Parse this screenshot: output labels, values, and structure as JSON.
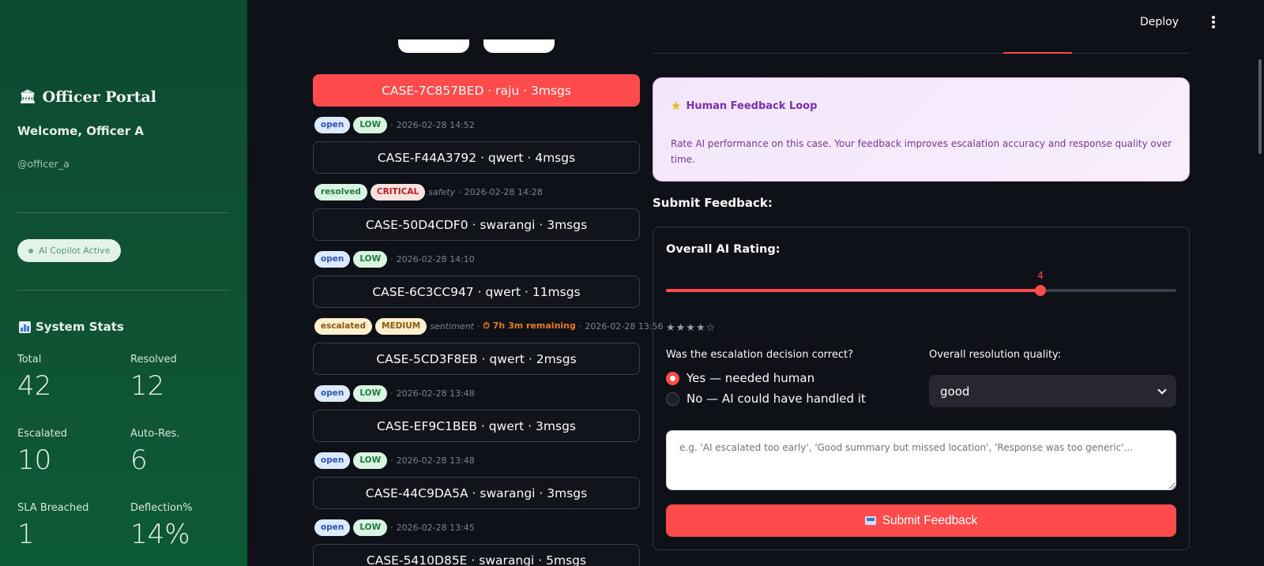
{
  "sidebar": {
    "portal_title": "Officer Portal",
    "welcome": "Welcome, Officer A",
    "username": "@officer_a",
    "copilot_status": "AI Copilot Active",
    "stats_title": "System Stats",
    "stats": [
      {
        "label": "Total",
        "value": "42"
      },
      {
        "label": "Resolved",
        "value": "12"
      },
      {
        "label": "Escalated",
        "value": "10"
      },
      {
        "label": "Auto-Res.",
        "value": "6"
      },
      {
        "label": "SLA Breached",
        "value": "1"
      },
      {
        "label": "Deflection%",
        "value": "14%"
      }
    ]
  },
  "header": {
    "deploy_label": "Deploy"
  },
  "cases": [
    {
      "label": "CASE-7C857BED · raju · 3msgs",
      "status": "open",
      "priority": "LOW",
      "category": "",
      "sla": "",
      "time": "2026-02-28 14:52"
    },
    {
      "label": "CASE-F44A3792 · qwert · 4msgs",
      "status": "resolved",
      "priority": "CRITICAL",
      "category": "safety",
      "sla": "",
      "time": "2026-02-28 14:28"
    },
    {
      "label": "CASE-50D4CDF0 · swarangi · 3msgs",
      "status": "open",
      "priority": "LOW",
      "category": "",
      "sla": "",
      "time": "2026-02-28 14:10"
    },
    {
      "label": "CASE-6C3CC947 · qwert · 11msgs",
      "status": "escalated",
      "priority": "MEDIUM",
      "category": "sentiment",
      "sla": "7h 3m remaining",
      "time": "2026-02-28 13:56"
    },
    {
      "label": "CASE-5CD3F8EB · qwert · 2msgs",
      "status": "open",
      "priority": "LOW",
      "category": "",
      "sla": "",
      "time": "2026-02-28 13:48"
    },
    {
      "label": "CASE-EF9C1BEB · qwert · 3msgs",
      "status": "open",
      "priority": "LOW",
      "category": "",
      "sla": "",
      "time": "2026-02-28 13:48"
    },
    {
      "label": "CASE-44C9DA5A · swarangi · 3msgs",
      "status": "open",
      "priority": "LOW",
      "category": "",
      "sla": "",
      "time": "2026-02-28 13:45"
    },
    {
      "label": "CASE-5410D85E · swarangi · 5msgs"
    }
  ],
  "feedback": {
    "card_title": "Human Feedback Loop",
    "card_body": "Rate AI performance on this case. Your feedback improves escalation accuracy and response quality over time.",
    "section_title": "Submit Feedback:",
    "rating_label": "Overall AI Rating:",
    "rating_value": 4,
    "rating_min": 1,
    "rating_max": 5,
    "rating_display": "4",
    "stars": "★★★★☆",
    "escalation_question": "Was the escalation decision correct?",
    "escalation_options": [
      "Yes — needed human",
      "No — AI could have handled it"
    ],
    "escalation_selected": 0,
    "quality_label": "Overall resolution quality:",
    "quality_value": "good",
    "comment_placeholder": "e.g. 'AI escalated too early', 'Good summary but missed location', 'Response was too generic'...",
    "submit_label": "Submit Feedback"
  },
  "colors": {
    "accent": "#ff4b4b",
    "sidebar_bg": "#0e5233",
    "app_bg": "#0e1117"
  }
}
